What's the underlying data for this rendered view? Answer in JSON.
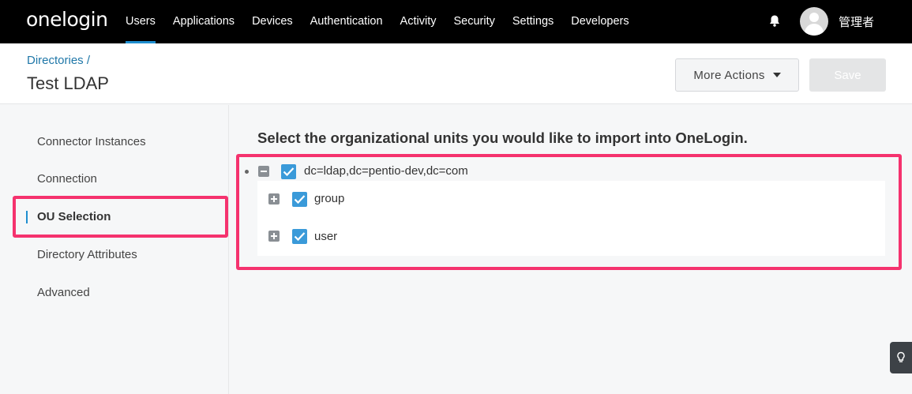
{
  "brand": {
    "logo_text": "onelogin",
    "accent_color": "#1f8ecf",
    "highlight_color": "#f5326e"
  },
  "topnav": {
    "items": [
      {
        "label": "Users",
        "active": true
      },
      {
        "label": "Applications",
        "active": false
      },
      {
        "label": "Devices",
        "active": false
      },
      {
        "label": "Authentication",
        "active": false
      },
      {
        "label": "Activity",
        "active": false
      },
      {
        "label": "Security",
        "active": false
      },
      {
        "label": "Settings",
        "active": false
      },
      {
        "label": "Developers",
        "active": false
      }
    ],
    "notification_icon": "bell-icon",
    "user": {
      "name": "管理者",
      "avatar_icon": "user-avatar-icon"
    }
  },
  "header": {
    "breadcrumb": "Directories /",
    "title": "Test LDAP",
    "more_actions_label": "More Actions",
    "save_label": "Save"
  },
  "sidebar": {
    "items": [
      {
        "label": "Connector Instances",
        "active": false
      },
      {
        "label": "Connection",
        "active": false
      },
      {
        "label": "OU Selection",
        "active": true
      },
      {
        "label": "Directory Attributes",
        "active": false
      },
      {
        "label": "Advanced",
        "active": false
      }
    ]
  },
  "main": {
    "heading": "Select the organizational units you would like to import into OneLogin.",
    "tree": {
      "root": {
        "label": "dc=ldap,dc=pentio-dev,dc=com",
        "checked": true,
        "expanded": true
      },
      "children": [
        {
          "label": "group",
          "checked": true,
          "expanded": false
        },
        {
          "label": "user",
          "checked": true,
          "expanded": false
        }
      ]
    }
  },
  "help_icon": "lightbulb-icon"
}
